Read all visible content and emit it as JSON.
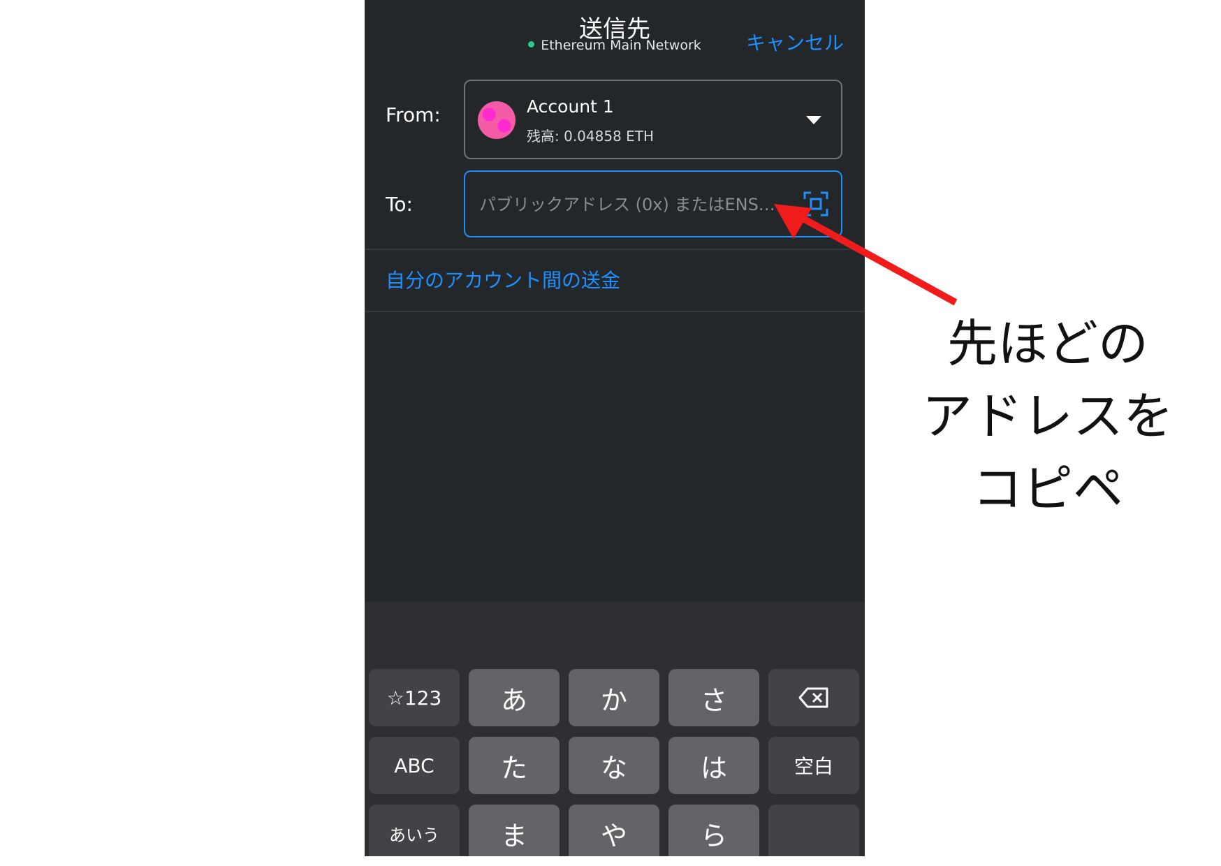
{
  "header": {
    "title": "送信先",
    "network": "Ethereum Main Network",
    "cancel_label": "キャンセル"
  },
  "from": {
    "label": "From:",
    "account_name": "Account 1",
    "balance": "残高: 0.04858 ETH"
  },
  "to": {
    "label": "To:",
    "placeholder": "パブリックアドレス (0x) またはENS…",
    "value": ""
  },
  "own_accounts_link": "自分のアカウント間の送金",
  "keyboard": {
    "row1": [
      "☆123",
      "あ",
      "か",
      "さ"
    ],
    "row2": [
      "ABC",
      "た",
      "な",
      "は",
      "空白"
    ],
    "row3": [
      "あいう",
      "ま",
      "や",
      "ら"
    ]
  },
  "annotation": {
    "line1": "先ほどの",
    "line2": "アドレスを",
    "line3": "コピペ"
  },
  "colors": {
    "background": "#24272a",
    "accent": "#1e8ffe",
    "network_dot": "#2ec98e",
    "arrow": "#f01c1c"
  }
}
